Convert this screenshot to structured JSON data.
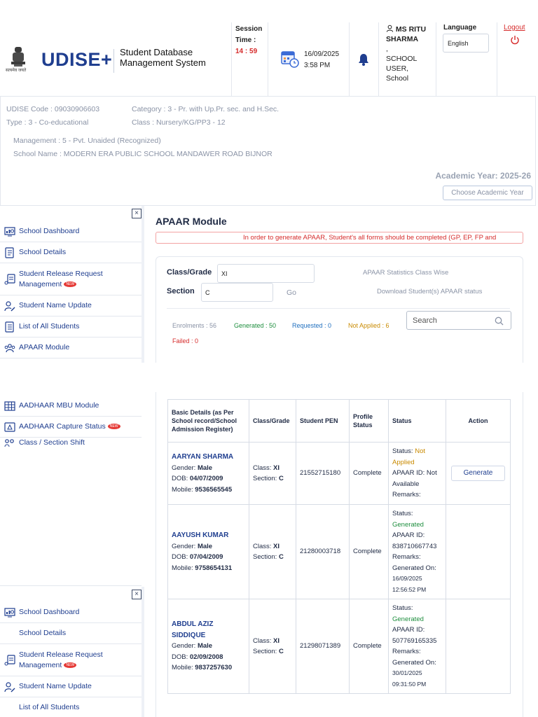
{
  "header": {
    "logo": "UDISE+",
    "emblem_caption": "सत्यमेव जयते",
    "app_title": "Student Database Management System",
    "session_label": "Session Time :",
    "session_time": "14 : 59",
    "date": "16/09/2025",
    "time": "3:58 PM",
    "user_name": "MS RITU SHARMA",
    "user_sep": ",",
    "user_role": "SCHOOL USER, School",
    "language_label": "Language",
    "language_value": "English",
    "logout_label": "Logout"
  },
  "school": {
    "udise_code": "UDISE Code : 09030906603",
    "category": "Category : 3 - Pr. with Up.Pr. sec. and H.Sec.",
    "type": "Type : 3 - Co-educational",
    "class": "Class : Nursery/KG/PP3 - 12",
    "management": "Management : 5 - Pvt. Unaided (Recognized)",
    "school_name": "School Name : MODERN ERA PUBLIC SCHOOL MANDAWER ROAD BIJNOR",
    "academic_year": "Academic Year: 2025-26",
    "choose_year": "Choose Academic Year"
  },
  "sidebar": {
    "close_symbol": "×",
    "new_tag": "NEW",
    "items_top": [
      {
        "label": "School Dashboard"
      },
      {
        "label": "School Details"
      },
      {
        "label": "Student Release Request Management"
      },
      {
        "label": "Student Name Update"
      },
      {
        "label": "List of All Students"
      },
      {
        "label": "APAAR Module"
      }
    ],
    "items_mid": [
      {
        "label": "AADHAAR MBU Module"
      },
      {
        "label": "AADHAAR Capture Status"
      },
      {
        "label": "Class / Section Shift"
      }
    ],
    "items_bottom": [
      {
        "label": "School Dashboard"
      },
      {
        "label": "School Details"
      },
      {
        "label": "Student Release Request Management"
      },
      {
        "label": "Student Name Update"
      },
      {
        "label": "List of All Students"
      }
    ]
  },
  "apaar": {
    "title": "APAAR Module",
    "warning": "In order to generate APAAR, Student's all forms should be completed (GP, EP, FP and",
    "class_label": "Class/Grade",
    "class_value": "XI",
    "section_label": "Section",
    "section_value": "C",
    "go_label": "Go",
    "stats_link": "APAAR Statistics Class Wise",
    "download_link": "Download Student(s) APAAR status",
    "stats": {
      "enrolments": "Enrolments : 56",
      "generated": "Generated : 50",
      "requested": "Requested : 0",
      "not_applied": "Not Applied : 6",
      "failed": "Failed : 0"
    },
    "search_placeholder": "Search",
    "colors": {
      "generated": "#1e8e3e",
      "requested": "#1f6fbf",
      "not_applied": "#c98a00",
      "failed": "#d62b2b"
    }
  },
  "table": {
    "headers": {
      "basic": "Basic Details (as Per School record/School Admission Register)",
      "class": "Class/Grade",
      "pen": "Student PEN",
      "profile": "Profile Status",
      "status": "Status",
      "action": "Action"
    },
    "labels": {
      "gender": "Gender: ",
      "dob": "DOB: ",
      "mobile": "Mobile: ",
      "class": "Class: ",
      "section": "Section: ",
      "status": "Status: ",
      "apaar_id": "APAAR ID: ",
      "remarks": "Remarks:",
      "generated_on": "Generated On:"
    },
    "rows": [
      {
        "name": "AARYAN SHARMA",
        "gender": "Male",
        "dob": "04/07/2009",
        "mobile": "9536565545",
        "class": "XI",
        "section": "C",
        "pen": "21552715180",
        "profile": "Complete",
        "status": "Not Applied",
        "apaar_id": "Not Available",
        "action": "Generate"
      },
      {
        "name": "AAYUSH KUMAR",
        "gender": "Male",
        "dob": "07/04/2009",
        "mobile": "9758654131",
        "class": "XI",
        "section": "C",
        "pen": "21280003718",
        "profile": "Complete",
        "status": "Generated",
        "apaar_id": "838710667743",
        "generated_on": "16/09/2025 12:56:52 PM"
      },
      {
        "name": "ABDUL AZIZ SIDDIQUE",
        "gender": "Male",
        "dob": "02/09/2008",
        "mobile": "9837257630",
        "class": "XI",
        "section": "C",
        "pen": "21298071389",
        "profile": "Complete",
        "status": "Generated",
        "apaar_id": "507769165335",
        "generated_on": "30/01/2025 09:31:50 PM"
      }
    ]
  }
}
